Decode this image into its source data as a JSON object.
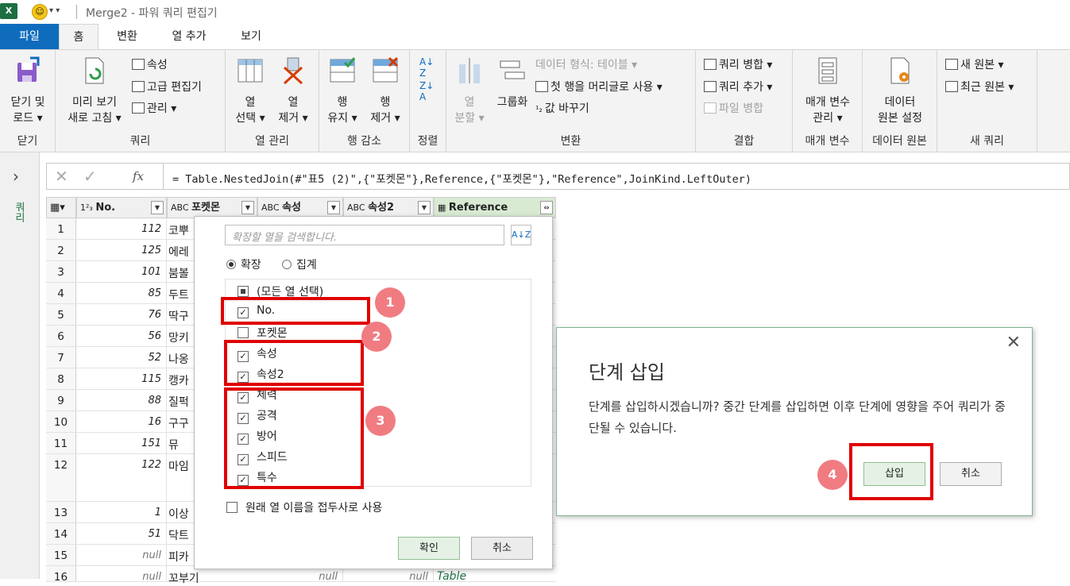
{
  "window": {
    "title": "Merge2 - 파워 쿼리 편집기",
    "app_icon": "excel-icon"
  },
  "tabs": [
    "파일",
    "홈",
    "변환",
    "열 추가",
    "보기"
  ],
  "ribbon": {
    "close_group": {
      "btn1": "닫기 및",
      "btn2": "로드 ▾",
      "label": "닫기"
    },
    "query_group": {
      "refresh1": "미리 보기",
      "refresh2": "새로 고침 ▾",
      "properties": "속성",
      "advanced_editor": "고급 편집기",
      "manage": "관리 ▾",
      "label": "쿼리"
    },
    "column_mgmt": {
      "choose1": "열",
      "choose2": "선택 ▾",
      "remove1": "열",
      "remove2": "제거 ▾",
      "label": "열 관리"
    },
    "row_reduce": {
      "keep1": "행",
      "keep2": "유지 ▾",
      "remove1": "행",
      "remove2": "제거 ▾",
      "label": "행 감소"
    },
    "sort": {
      "label": "정렬"
    },
    "transform": {
      "split1": "열",
      "split2": "분할 ▾",
      "group_by": "그룹화",
      "data_type": "데이터 형식: 테이블 ▾",
      "first_row_header": "첫 행을 머리글로 사용 ▾",
      "replace_values": "값 바꾸기",
      "label": "변환"
    },
    "combine": {
      "merge": "쿼리 병합 ▾",
      "append": "쿼리 추가 ▾",
      "combine_files": "파일 병합",
      "label": "결합"
    },
    "params": {
      "manage1": "매개 변수",
      "manage2": "관리 ▾",
      "label": "매개 변수"
    },
    "datasource": {
      "settings1": "데이터",
      "settings2": "원본 설정",
      "label": "데이터 원본"
    },
    "new_query": {
      "new_source": "새 원본 ▾",
      "recent_source": "최근 원본 ▾",
      "label": "새 쿼리"
    }
  },
  "left_panel": {
    "label": "쿼리"
  },
  "formula_bar": {
    "text": "= Table.NestedJoin(#\"표5 (2)\",{\"포켓몬\"},Reference,{\"포켓몬\"},\"Reference\",JoinKind.LeftOuter)"
  },
  "grid": {
    "columns": [
      "No.",
      "포켓몬",
      "속성",
      "속성2",
      "Reference"
    ],
    "type_prefix": [
      "1²₃",
      "A^B_C",
      "A^B_C",
      "A^B_C",
      "▦"
    ],
    "rows": [
      {
        "n": "1",
        "no": "112",
        "name": "코뿌"
      },
      {
        "n": "2",
        "no": "125",
        "name": "에레"
      },
      {
        "n": "3",
        "no": "101",
        "name": "붐볼"
      },
      {
        "n": "4",
        "no": "85",
        "name": "두트"
      },
      {
        "n": "5",
        "no": "76",
        "name": "딱구"
      },
      {
        "n": "6",
        "no": "56",
        "name": "망키"
      },
      {
        "n": "7",
        "no": "52",
        "name": "나옹"
      },
      {
        "n": "8",
        "no": "115",
        "name": "캥카"
      },
      {
        "n": "9",
        "no": "88",
        "name": "질퍽"
      },
      {
        "n": "10",
        "no": "16",
        "name": "구구"
      },
      {
        "n": "11",
        "no": "151",
        "name": "뮤"
      },
      {
        "n": "12",
        "no": "122",
        "name": "마임"
      },
      {
        "n": "13",
        "no": "1",
        "name": "이상"
      },
      {
        "n": "14",
        "no": "51",
        "name": "닥트"
      },
      {
        "n": "15",
        "no": "null",
        "name": "피카"
      },
      {
        "n": "16",
        "no": "null",
        "name": "꼬부기"
      }
    ],
    "row16_extra": {
      "c3": "null",
      "c4": "null",
      "c5": "Table"
    }
  },
  "expand_popup": {
    "search_placeholder": "확장할 열을 검색합니다.",
    "radio_expand": "확장",
    "radio_aggregate": "집계",
    "select_all": "(모든 열 선택)",
    "items": [
      "No.",
      "포켓몬",
      "속성",
      "속성2",
      "체력",
      "공격",
      "방어",
      "스피드",
      "특수"
    ],
    "checked": [
      true,
      false,
      true,
      true,
      true,
      true,
      true,
      true,
      true
    ],
    "prefix_option": "원래 열 이름을 접두사로 사용",
    "ok": "확인",
    "cancel": "취소"
  },
  "badges": [
    "1",
    "2",
    "3",
    "4"
  ],
  "dialog": {
    "title": "단계 삽입",
    "message": "단계를 삽입하시겠습니까? 중간 단계를 삽입하면 이후 단계에 영향을 주어 쿼리가 중단될 수 있습니다.",
    "insert": "삽입",
    "cancel": "취소"
  },
  "colors": {
    "accent": "#0f6cbd",
    "highlight_red": "#e00000",
    "badge": "#f07c82",
    "excel_green": "#1d6f42"
  }
}
